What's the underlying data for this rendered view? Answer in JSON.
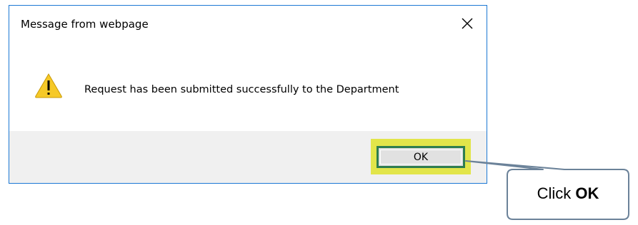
{
  "dialog": {
    "title": "Message from webpage",
    "close_icon": "close-icon",
    "icon": "warning-icon",
    "message": "Request has been submitted successfully to the Department",
    "ok_label": "OK"
  },
  "callout": {
    "prefix": "Click ",
    "emphasis": "OK"
  },
  "colors": {
    "window_border": "#1b78d4",
    "footer_bg": "#f0f0f0",
    "highlight": "#e2e54a",
    "ok_border": "#2e7d4f",
    "callout_border": "#6b8299",
    "warning_fill": "#f6c928"
  }
}
